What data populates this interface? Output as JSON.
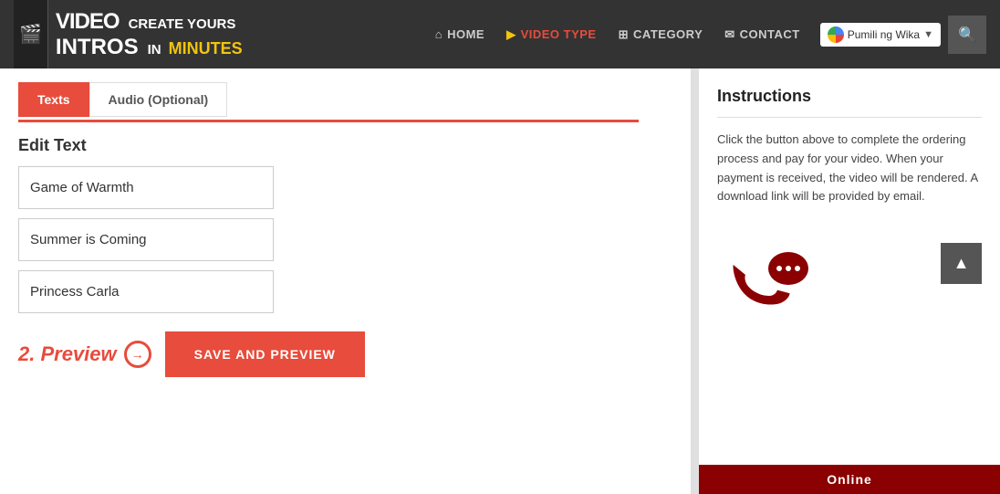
{
  "header": {
    "logo": {
      "video": "VIDEO",
      "intros": "INTROS",
      "create": "CREATE YOURS",
      "in": "IN",
      "minutes": "MINUTES"
    },
    "nav": [
      {
        "id": "home",
        "label": "HOME",
        "icon": "⌂",
        "active": false
      },
      {
        "id": "video-type",
        "label": "VIDEO TYPE",
        "icon": "▶",
        "active": true
      },
      {
        "id": "category",
        "label": "CATEGORY",
        "icon": "⊞",
        "active": false
      },
      {
        "id": "contact",
        "label": "CONTACT",
        "icon": "✉",
        "active": false
      }
    ],
    "translate_label": "Pumili ng Wika",
    "search_icon": "🔍"
  },
  "tabs": [
    {
      "id": "texts",
      "label": "Texts",
      "active": true
    },
    {
      "id": "audio",
      "label": "Audio (Optional)",
      "active": false
    }
  ],
  "edit_text": {
    "label": "Edit Text",
    "fields": [
      {
        "id": "field1",
        "value": "Game of Warmth"
      },
      {
        "id": "field2",
        "value": "Summer is Coming"
      },
      {
        "id": "field3",
        "value": "Princess Carla"
      }
    ]
  },
  "preview": {
    "label": "2. Preview",
    "arrow": "→",
    "button_label": "SAVE AND PREVIEW"
  },
  "sidebar": {
    "instructions_title": "Instructions",
    "instructions_text": "Click the button above to complete the ordering process and pay for your video. When your payment is received, the video will be rendered. A download link will be provided by email.",
    "online_label": "Online"
  },
  "colors": {
    "accent": "#e74c3c",
    "dark_red": "#8b0000",
    "header_bg": "#333333",
    "tab_active_bg": "#e74c3c"
  }
}
